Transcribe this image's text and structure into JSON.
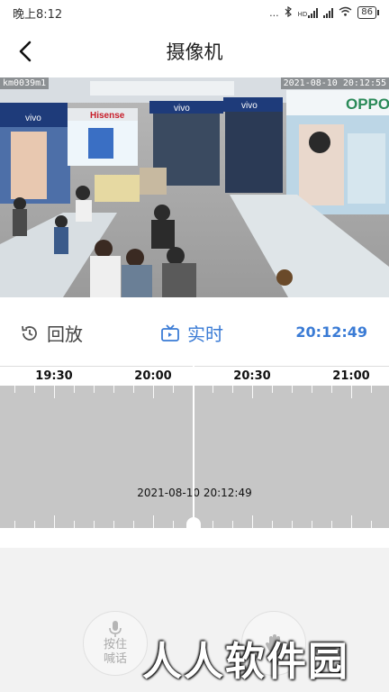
{
  "status_bar": {
    "time": "晚上8:12",
    "dots": "...",
    "network": "HD",
    "battery": "86"
  },
  "nav": {
    "title": "摄像机"
  },
  "video": {
    "camera_id": "km0039m1",
    "timestamp": "2021-08-10 20:12:55",
    "signs": [
      "vivo",
      "Hisense",
      "vivo",
      "vivo",
      "OPPO"
    ]
  },
  "controls": {
    "playback_label": "回放",
    "live_label": "实时",
    "current_time": "20:12:49"
  },
  "timeline": {
    "labels": [
      "19:30",
      "20:00",
      "20:30",
      "21:00"
    ],
    "datetime": "2021-08-10 20:12:49"
  },
  "actions": {
    "talk_line1": "按住",
    "talk_line2": "喊话"
  },
  "watermark": "人人软件园",
  "colors": {
    "accent": "#3a7bd5",
    "timeline_bg": "#c6c6c6",
    "panel_bg": "#f2f2f2"
  }
}
